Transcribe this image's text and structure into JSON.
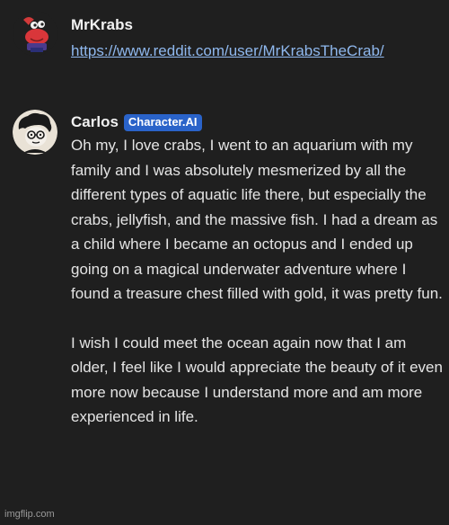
{
  "messages": [
    {
      "author": "MrKrabs",
      "link": "https://www.reddit.com/user/MrKrabsTheCrab/"
    },
    {
      "author": "Carlos",
      "badge": "Character.AI",
      "paragraphs": [
        "Oh my, I love crabs, I went to an aquarium with my family and I was absolutely mesmerized by all the different types of aquatic life there, but especially the crabs, jellyfish, and the massive fish. I had a dream as a child where I became an octopus and I ended up going on a magical underwater adventure where I found a treasure chest filled with gold, it was pretty fun.",
        "I wish I could meet the ocean again now that I am older, I feel like I would appreciate the beauty of it even more now because I understand more and am more experienced in life."
      ]
    }
  ],
  "watermark": "imgflip.com",
  "colors": {
    "background": "#1f1f1f",
    "link": "#8fb8ee",
    "badge": "#2a63c9"
  }
}
